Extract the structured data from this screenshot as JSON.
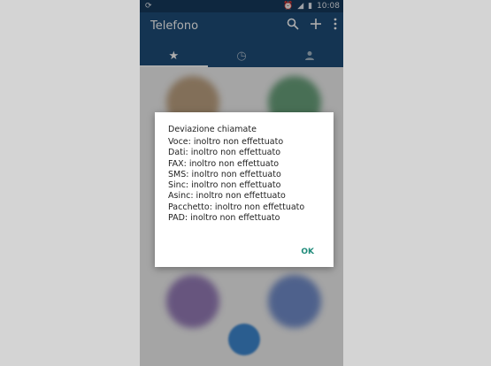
{
  "status_bar": {
    "time": "10:08"
  },
  "app_bar": {
    "title": "Telefono"
  },
  "tabs": [
    {
      "icon": "star-icon",
      "glyph": "★",
      "active": true
    },
    {
      "icon": "clock-icon",
      "glyph": "◷",
      "active": false
    },
    {
      "icon": "person-icon",
      "glyph": "👤",
      "active": false
    }
  ],
  "dialog": {
    "title": "Deviazione chiamate",
    "lines": [
      "Voce: inoltro non effettuato",
      "Dati: inoltro non effettuato",
      "FAX: inoltro non effettuato",
      "SMS: inoltro non effettuato",
      "Sinc: inoltro non effettuato",
      "Asinc: inoltro non effettuato",
      "Pacchetto: inoltro non effettuato",
      "PAD: inoltro non effettuato"
    ],
    "ok_label": "OK"
  },
  "colors": {
    "app_bar": "#1e4d79",
    "status_bar": "#163a5e",
    "accent": "#1f8b7a"
  }
}
